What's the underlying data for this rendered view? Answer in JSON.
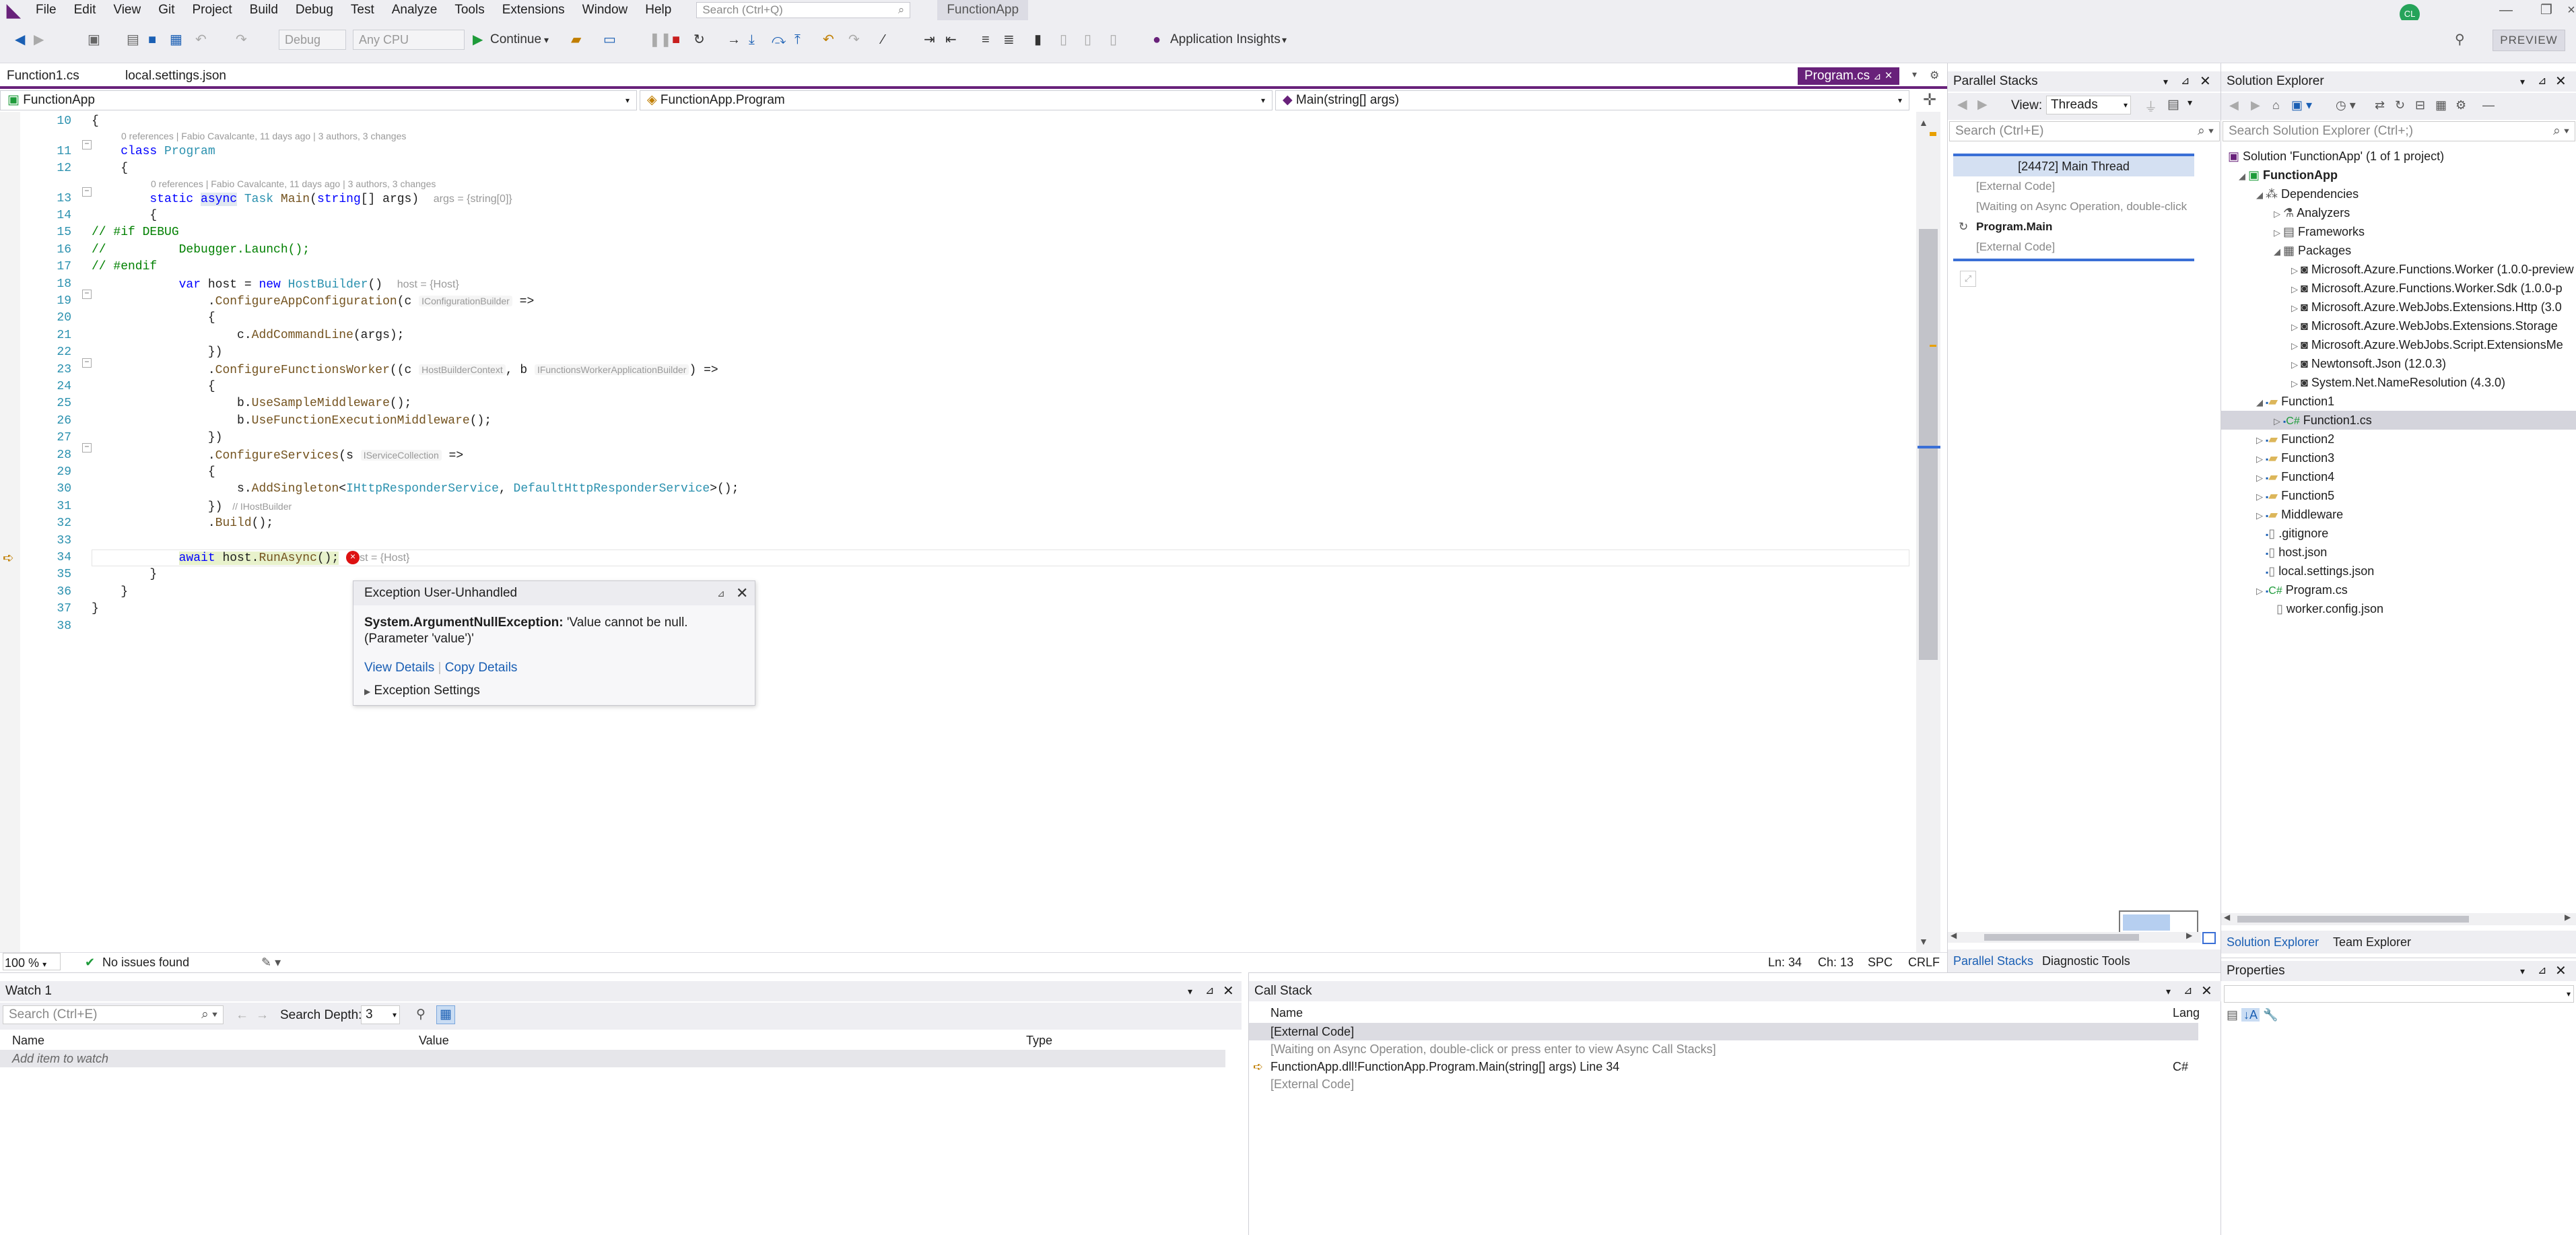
{
  "menu": {
    "items": [
      "File",
      "Edit",
      "View",
      "Git",
      "Project",
      "Build",
      "Debug",
      "Test",
      "Analyze",
      "Tools",
      "Extensions",
      "Window",
      "Help"
    ],
    "search_placeholder": "Search (Ctrl+Q)",
    "app_title": "FunctionApp",
    "user_initials": "CL",
    "preview_label": "PREVIEW"
  },
  "toolbar": {
    "config": "Debug",
    "platform": "Any CPU",
    "continue_label": "Continue",
    "insights_label": "Application Insights"
  },
  "tabs": {
    "left": [
      "Function1.cs",
      "local.settings.json"
    ],
    "active": "Program.cs"
  },
  "nav": {
    "project": "FunctionApp",
    "class": "FunctionApp.Program",
    "member": "Main(string[] args)"
  },
  "code": {
    "lens1": "0 references | Fabio Cavalcante, 11 days ago | 3 authors, 3 changes",
    "lens2": "0 references | Fabio Cavalcante, 11 days ago | 3 authors, 3 changes",
    "line_numbers": [
      "10",
      "11",
      "12",
      "13",
      "14",
      "15",
      "16",
      "17",
      "18",
      "19",
      "20",
      "21",
      "22",
      "23",
      "24",
      "25",
      "26",
      "27",
      "28",
      "29",
      "30",
      "31",
      "32",
      "33",
      "34",
      "35",
      "36",
      "37",
      "38"
    ],
    "args_hint": "args = {string[0]}",
    "host_hint": "host = {Host}",
    "builder_hint": "IConfigurationBuilder",
    "context_hint": "HostBuilderContext",
    "worker_hint": "IFunctionsWorkerApplicationBuilder",
    "services_hint": "IServiceCollection",
    "ihost_hint": "// IHostBuilder",
    "await_hint": "st = {Host}"
  },
  "exception": {
    "title": "Exception User-Unhandled",
    "type": "System.ArgumentNullException:",
    "message": "'Value cannot be null. (Parameter 'value')'",
    "view_details": "View Details",
    "copy_details": "Copy Details",
    "settings": "Exception Settings"
  },
  "status": {
    "zoom": "100 %",
    "issues": "No issues found",
    "ln": "Ln: 34",
    "ch": "Ch: 13",
    "spc": "SPC",
    "crlf": "CRLF"
  },
  "watch": {
    "title": "Watch 1",
    "search_placeholder": "Search (Ctrl+E)",
    "depth_label": "Search Depth:",
    "depth_value": "3",
    "columns": [
      "Name",
      "Value",
      "Type"
    ],
    "add_item": "Add item to watch"
  },
  "callstack": {
    "title": "Call Stack",
    "columns": [
      "Name",
      "Lang"
    ],
    "rows": [
      {
        "name": "[External Code]",
        "lang": ""
      },
      {
        "name": "[Waiting on Async Operation, double-click or press enter to view Async Call Stacks]",
        "lang": ""
      },
      {
        "name": "FunctionApp.dll!FunctionApp.Program.Main(string[] args) Line 34",
        "lang": "C#"
      },
      {
        "name": "[External Code]",
        "lang": ""
      }
    ]
  },
  "parallel": {
    "title": "Parallel Stacks",
    "view_label": "View:",
    "view_value": "Threads",
    "search_placeholder": "Search (Ctrl+E)",
    "thread_header": "[24472] Main Thread",
    "frames": [
      "[External Code]",
      "[Waiting on Async Operation, double-click",
      "Program.Main",
      "[External Code]"
    ],
    "tabs": [
      "Parallel Stacks",
      "Diagnostic Tools"
    ]
  },
  "solution": {
    "title": "Solution Explorer",
    "search_placeholder": "Search Solution Explorer (Ctrl+;)",
    "root": "Solution 'FunctionApp' (1 of 1 project)",
    "project": "FunctionApp",
    "dependencies": "Dependencies",
    "analyzers": "Analyzers",
    "frameworks": "Frameworks",
    "packages": "Packages",
    "package_items": [
      "Microsoft.Azure.Functions.Worker (1.0.0-preview",
      "Microsoft.Azure.Functions.Worker.Sdk (1.0.0-p",
      "Microsoft.Azure.WebJobs.Extensions.Http (3.0",
      "Microsoft.Azure.WebJobs.Extensions.Storage",
      "Microsoft.Azure.WebJobs.Script.ExtensionsMe",
      "Newtonsoft.Json (12.0.3)",
      "System.Net.NameResolution (4.3.0)"
    ],
    "function1": "Function1",
    "function1_cs": "Function1.cs",
    "folders": [
      "Function2",
      "Function3",
      "Function4",
      "Function5",
      "Middleware"
    ],
    "files": [
      ".gitignore",
      "host.json",
      "local.settings.json"
    ],
    "program_cs": "Program.cs",
    "worker_config": "worker.config.json",
    "tabs": [
      "Solution Explorer",
      "Team Explorer"
    ]
  },
  "properties": {
    "title": "Properties"
  }
}
